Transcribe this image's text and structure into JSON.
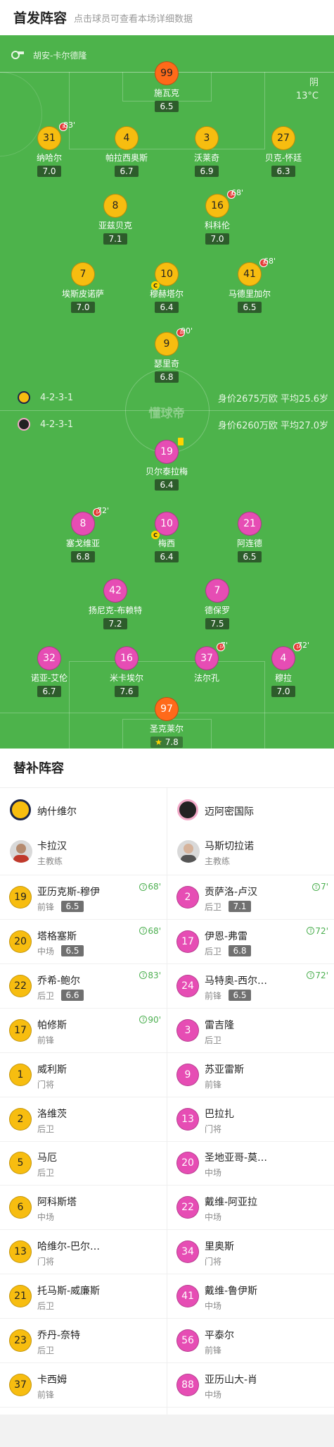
{
  "header": {
    "title": "首发阵容",
    "subtitle": "点击球员可查看本场详细数据"
  },
  "pitch": {
    "referee": "胡安-卡尔德隆",
    "weather": "阴",
    "temperature": "13°C",
    "watermark": "懂球帝",
    "home_team": {
      "formation": "4-2-3-1",
      "value_info": "身价2675万欧 平均25.6岁"
    },
    "away_team": {
      "formation": "4-2-3-1",
      "value_info": "身价6260万欧 平均27.0岁"
    },
    "home_players": [
      {
        "num": "99",
        "name": "施瓦克",
        "rating": "6.5",
        "gk": true
      },
      {
        "num": "31",
        "name": "纳哈尔",
        "rating": "7.0",
        "sub": "83'"
      },
      {
        "num": "4",
        "name": "帕拉西奥斯",
        "rating": "6.7"
      },
      {
        "num": "3",
        "name": "沃莱奇",
        "rating": "6.9"
      },
      {
        "num": "27",
        "name": "贝克-怀廷",
        "rating": "6.3"
      },
      {
        "num": "8",
        "name": "亚兹贝克",
        "rating": "7.1"
      },
      {
        "num": "16",
        "name": "科科伦",
        "rating": "7.0",
        "sub": "68'"
      },
      {
        "num": "7",
        "name": "埃斯皮诺萨",
        "rating": "7.0"
      },
      {
        "num": "10",
        "name": "穆赫塔尔",
        "rating": "6.4",
        "captain": "C"
      },
      {
        "num": "41",
        "name": "马德里加尔",
        "rating": "6.5",
        "sub": "68'"
      },
      {
        "num": "9",
        "name": "瑟里奇",
        "rating": "6.8",
        "sub": "90'"
      }
    ],
    "away_players": [
      {
        "num": "19",
        "name": "贝尔泰拉梅",
        "rating": "6.4",
        "card": "yellow"
      },
      {
        "num": "8",
        "name": "塞戈维亚",
        "rating": "6.8",
        "sub": "72'"
      },
      {
        "num": "10",
        "name": "梅西",
        "rating": "6.4",
        "captain": "C"
      },
      {
        "num": "21",
        "name": "阿连德",
        "rating": "6.5"
      },
      {
        "num": "42",
        "name": "扬尼克-布赖特",
        "rating": "7.2"
      },
      {
        "num": "7",
        "name": "德保罗",
        "rating": "7.5"
      },
      {
        "num": "32",
        "name": "诺亚-艾伦",
        "rating": "6.7"
      },
      {
        "num": "16",
        "name": "米卡埃尔",
        "rating": "7.6"
      },
      {
        "num": "37",
        "name": "法尔孔",
        "rating": "",
        "sub": "7'"
      },
      {
        "num": "4",
        "name": "穆拉",
        "rating": "7.0",
        "sub": "72'"
      },
      {
        "num": "97",
        "name": "圣克莱尔",
        "rating": "7.8",
        "gk": true,
        "star": true
      }
    ]
  },
  "subs": {
    "title": "替补阵容",
    "home": {
      "team": "纳什维尔",
      "coach": {
        "name": "卡拉汉",
        "role": "主教练"
      },
      "players": [
        {
          "num": "19",
          "name": "亚历克斯-穆伊",
          "pos": "前锋",
          "rating": "6.5",
          "in": "68'"
        },
        {
          "num": "20",
          "name": "塔格塞斯",
          "pos": "中场",
          "rating": "6.5",
          "in": "68'"
        },
        {
          "num": "22",
          "name": "乔希-鲍尔",
          "pos": "后卫",
          "rating": "6.6",
          "in": "83'"
        },
        {
          "num": "17",
          "name": "帕修斯",
          "pos": "前锋",
          "rating": "",
          "in": "90'"
        },
        {
          "num": "1",
          "name": "威利斯",
          "pos": "门将"
        },
        {
          "num": "2",
          "name": "洛维茨",
          "pos": "后卫"
        },
        {
          "num": "5",
          "name": "马厄",
          "pos": "后卫"
        },
        {
          "num": "6",
          "name": "阿科斯塔",
          "pos": "中场"
        },
        {
          "num": "13",
          "name": "哈维尔-巴尔…",
          "pos": "门将"
        },
        {
          "num": "21",
          "name": "托马斯-威廉斯",
          "pos": "后卫"
        },
        {
          "num": "23",
          "name": "乔丹-奈特",
          "pos": "后卫"
        },
        {
          "num": "37",
          "name": "卡西姆",
          "pos": "前锋"
        }
      ]
    },
    "away": {
      "team": "迈阿密国际",
      "coach": {
        "name": "马斯切拉诺",
        "role": "主教练"
      },
      "players": [
        {
          "num": "2",
          "name": "贡萨洛-卢汉",
          "pos": "后卫",
          "rating": "7.1",
          "in": "7'"
        },
        {
          "num": "17",
          "name": "伊恩-弗雷",
          "pos": "后卫",
          "rating": "6.8",
          "in": "72'"
        },
        {
          "num": "24",
          "name": "马特奥-西尔…",
          "pos": "前锋",
          "rating": "6.5",
          "in": "72'"
        },
        {
          "num": "3",
          "name": "雷吉隆",
          "pos": "后卫"
        },
        {
          "num": "9",
          "name": "苏亚雷斯",
          "pos": "前锋"
        },
        {
          "num": "13",
          "name": "巴拉扎",
          "pos": "门将"
        },
        {
          "num": "20",
          "name": "圣地亚哥-莫…",
          "pos": "中场"
        },
        {
          "num": "22",
          "name": "戴维-阿亚拉",
          "pos": "中场"
        },
        {
          "num": "34",
          "name": "里奥斯",
          "pos": "门将"
        },
        {
          "num": "41",
          "name": "戴维-鲁伊斯",
          "pos": "中场"
        },
        {
          "num": "56",
          "name": "平泰尔",
          "pos": "前锋"
        },
        {
          "num": "88",
          "name": "亚历山大-肖",
          "pos": "中场"
        }
      ]
    }
  }
}
